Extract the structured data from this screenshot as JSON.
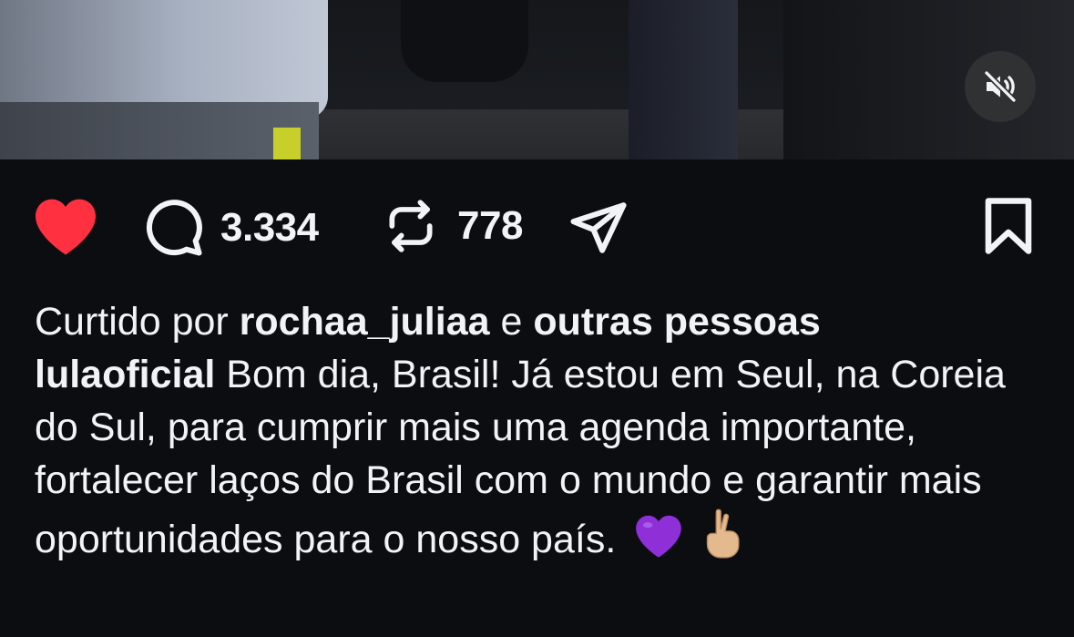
{
  "media": {
    "mute_icon": "speaker-muted-icon"
  },
  "actions": {
    "like_icon": "heart-filled-icon",
    "like_color": "#ff3040",
    "comment_icon": "comment-bubble-icon",
    "comment_count": "3.334",
    "repost_icon": "repost-arrows-icon",
    "repost_count": "778",
    "share_icon": "paper-plane-icon",
    "save_icon": "bookmark-icon"
  },
  "likes": {
    "prefix": "Curtido por",
    "user": "rochaa_juliaa",
    "connector": "e",
    "others": "outras pessoas"
  },
  "caption": {
    "username": "lulaoficial",
    "text": "Bom dia, Brasil! Já estou em Seul, na Coreia do Sul, para cumprir mais uma agenda importante, fortalecer laços do Brasil com o mundo e garantir mais oportunidades para o nosso país.",
    "emojis": [
      "purple-heart-emoji",
      "crossed-fingers-emoji"
    ]
  }
}
